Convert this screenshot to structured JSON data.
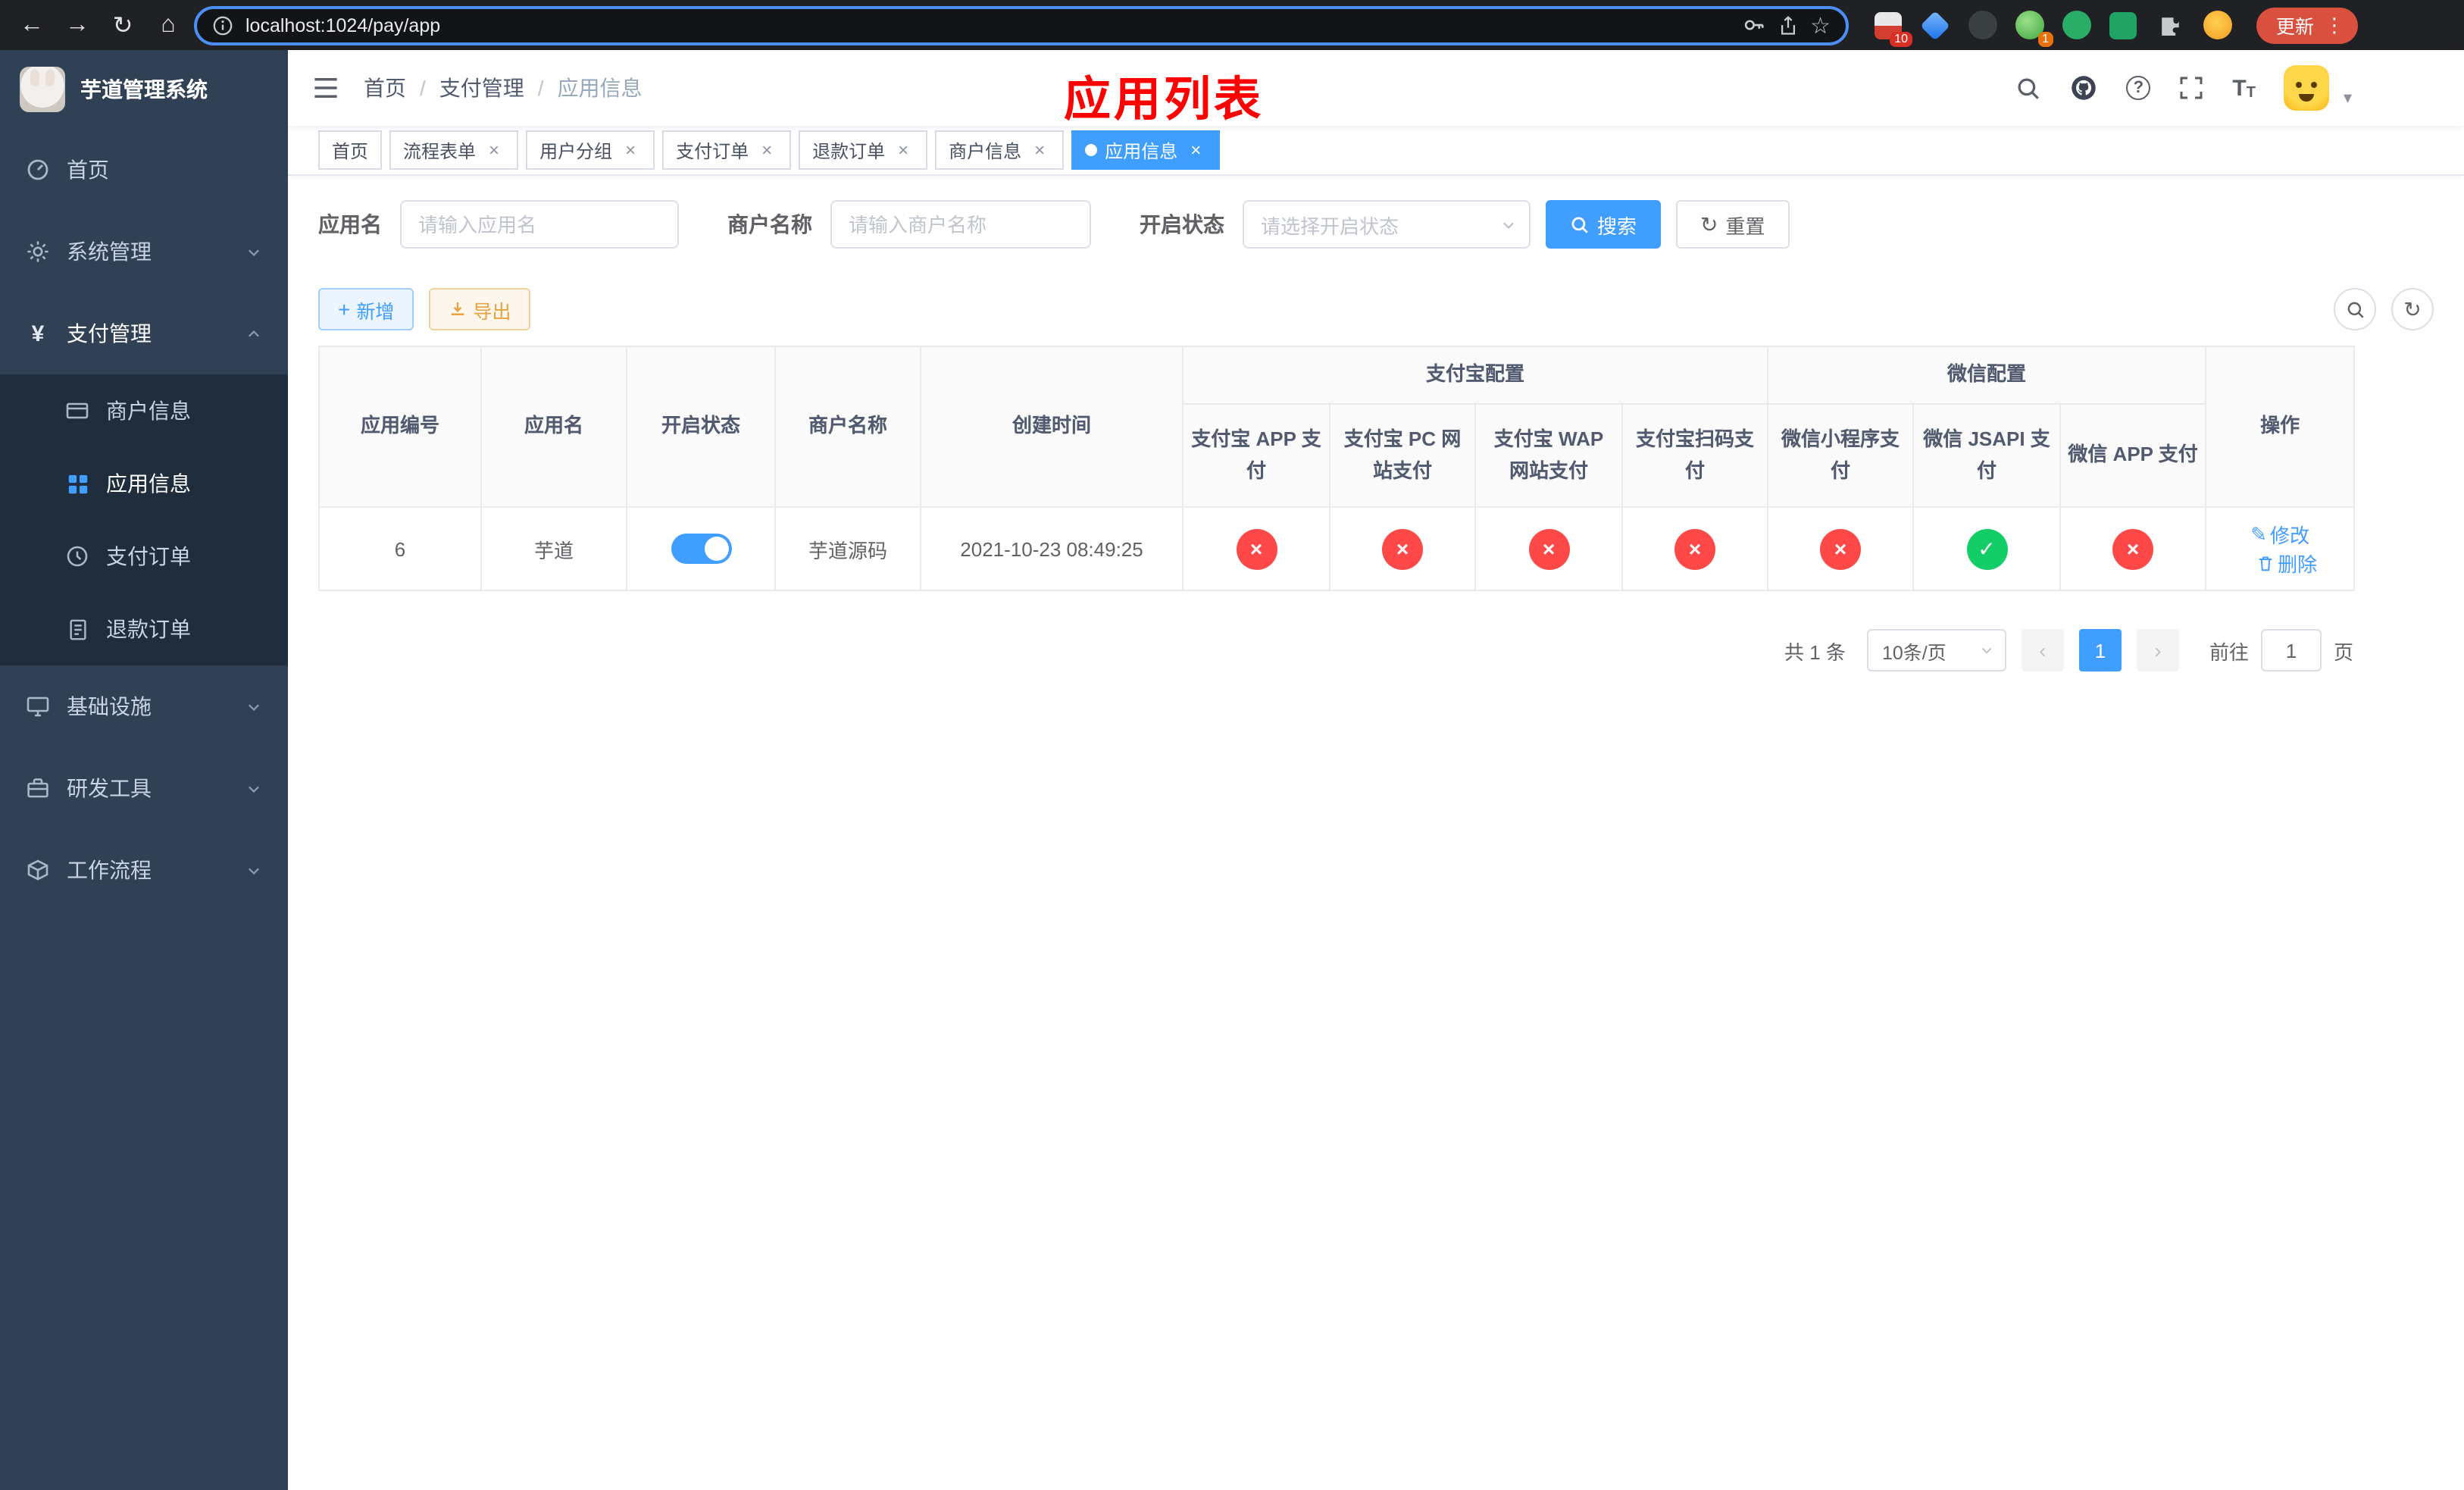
{
  "browser": {
    "url": "localhost:1024/pay/app",
    "update_label": "更新",
    "ext_badges": {
      "first": "10",
      "second": "1"
    }
  },
  "icons": {
    "back": "←",
    "forward": "→",
    "reload": "↻",
    "home": "⌂",
    "star": "☆",
    "question": "?",
    "close": "×",
    "dots": "⋮",
    "caret_down": "▾",
    "plus": "+",
    "yen": "¥",
    "edit": "✎",
    "check": "✓",
    "cross": "×",
    "font_large": "T",
    "font_small": "T",
    "prev": "‹",
    "next": "›"
  },
  "sidebar": {
    "app_title": "芋道管理系统",
    "items": {
      "home": "首页",
      "system": "系统管理",
      "payment": "支付管理",
      "infra": "基础设施",
      "devtools": "研发工具",
      "workflow": "工作流程"
    },
    "payment_children": {
      "merchant": "商户信息",
      "app": "应用信息",
      "pay_order": "支付订单",
      "refund_order": "退款订单"
    }
  },
  "header": {
    "breadcrumb": {
      "level1": "首页",
      "level2": "支付管理",
      "level3": "应用信息",
      "separator": "/"
    },
    "annotation": "应用列表"
  },
  "tabs": {
    "items": [
      {
        "label": "首页",
        "closable": false,
        "active": false
      },
      {
        "label": "流程表单",
        "closable": true,
        "active": false
      },
      {
        "label": "用户分组",
        "closable": true,
        "active": false
      },
      {
        "label": "支付订单",
        "closable": true,
        "active": false
      },
      {
        "label": "退款订单",
        "closable": true,
        "active": false
      },
      {
        "label": "商户信息",
        "closable": true,
        "active": false
      },
      {
        "label": "应用信息",
        "closable": true,
        "active": true
      }
    ]
  },
  "filters": {
    "app_name": {
      "label": "应用名",
      "placeholder": "请输入应用名"
    },
    "merchant_name": {
      "label": "商户名称",
      "placeholder": "请输入商户名称"
    },
    "status": {
      "label": "开启状态",
      "placeholder": "请选择开启状态"
    },
    "search": "搜索",
    "reset": "重置"
  },
  "toolbar": {
    "add": "新增",
    "export": "导出"
  },
  "table": {
    "headers": {
      "app_id": "应用编号",
      "app_name": "应用名",
      "status": "开启状态",
      "merchant_name": "商户名称",
      "create_time": "创建时间",
      "alipay_group": "支付宝配置",
      "wechat_group": "微信配置",
      "alipay_app": "支付宝 APP 支付",
      "alipay_pc": "支付宝 PC 网站支付",
      "alipay_wap": "支付宝 WAP 网站支付",
      "alipay_qr": "支付宝扫码支付",
      "wechat_mini": "微信小程序支付",
      "wechat_jsapi": "微信 JSAPI 支付",
      "wechat_app": "微信 APP 支付",
      "ops": "操作"
    },
    "row": {
      "app_id": "6",
      "app_name": "芋道",
      "enabled": true,
      "merchant_name": "芋道源码",
      "create_time": "2021-10-23 08:49:25",
      "alipay_app": false,
      "alipay_pc": false,
      "alipay_wap": false,
      "alipay_qr": false,
      "wechat_mini": false,
      "wechat_jsapi": true,
      "wechat_app": false,
      "edit": "修改",
      "delete": "删除"
    }
  },
  "pagination": {
    "total": "共 1 条",
    "page_size": "10条/页",
    "page": "1",
    "goto_label": "前往",
    "goto_value": "1",
    "goto_unit": "页"
  },
  "colors": {
    "primary": "#409EFF",
    "success": "#13CE66",
    "danger": "#FF4949",
    "warning_text": "#E6A23C",
    "annotation": "#FF0000",
    "sidebar_bg": "#304156",
    "submenu_bg": "#1F2D3D",
    "update_button": "#D9503F"
  }
}
